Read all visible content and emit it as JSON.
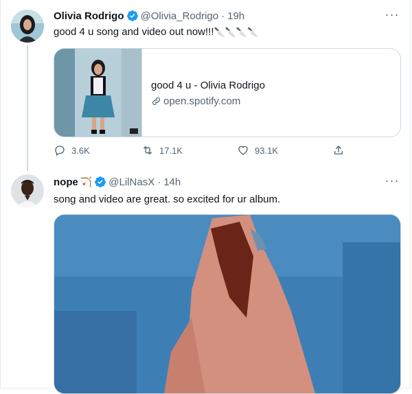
{
  "tweet1": {
    "name": "Olivia Rodrigo",
    "handle": "@Olivia_Rodrigo",
    "time": "19h",
    "text": "good 4 u song and video out now!!!",
    "emoji": "🔪🔪🔪🔪",
    "card": {
      "title": "good 4 u - Olivia Rodrigo",
      "domain": "open.spotify.com"
    },
    "stats": {
      "replies": "3.6K",
      "retweets": "17.1K",
      "likes": "93.1K"
    },
    "icons": [
      "verified-badge-icon",
      "more-icon",
      "link-icon",
      "reply-icon",
      "retweet-icon",
      "like-icon",
      "share-icon"
    ]
  },
  "tweet2": {
    "name": "nope",
    "name_emoji": "🏹",
    "handle": "@LilNasX",
    "time": "14h",
    "text": "song and video are great. so excited for ur album."
  },
  "colors": {
    "accent": "#1d9bf0",
    "muted": "#536471",
    "border": "#cfd9de"
  }
}
